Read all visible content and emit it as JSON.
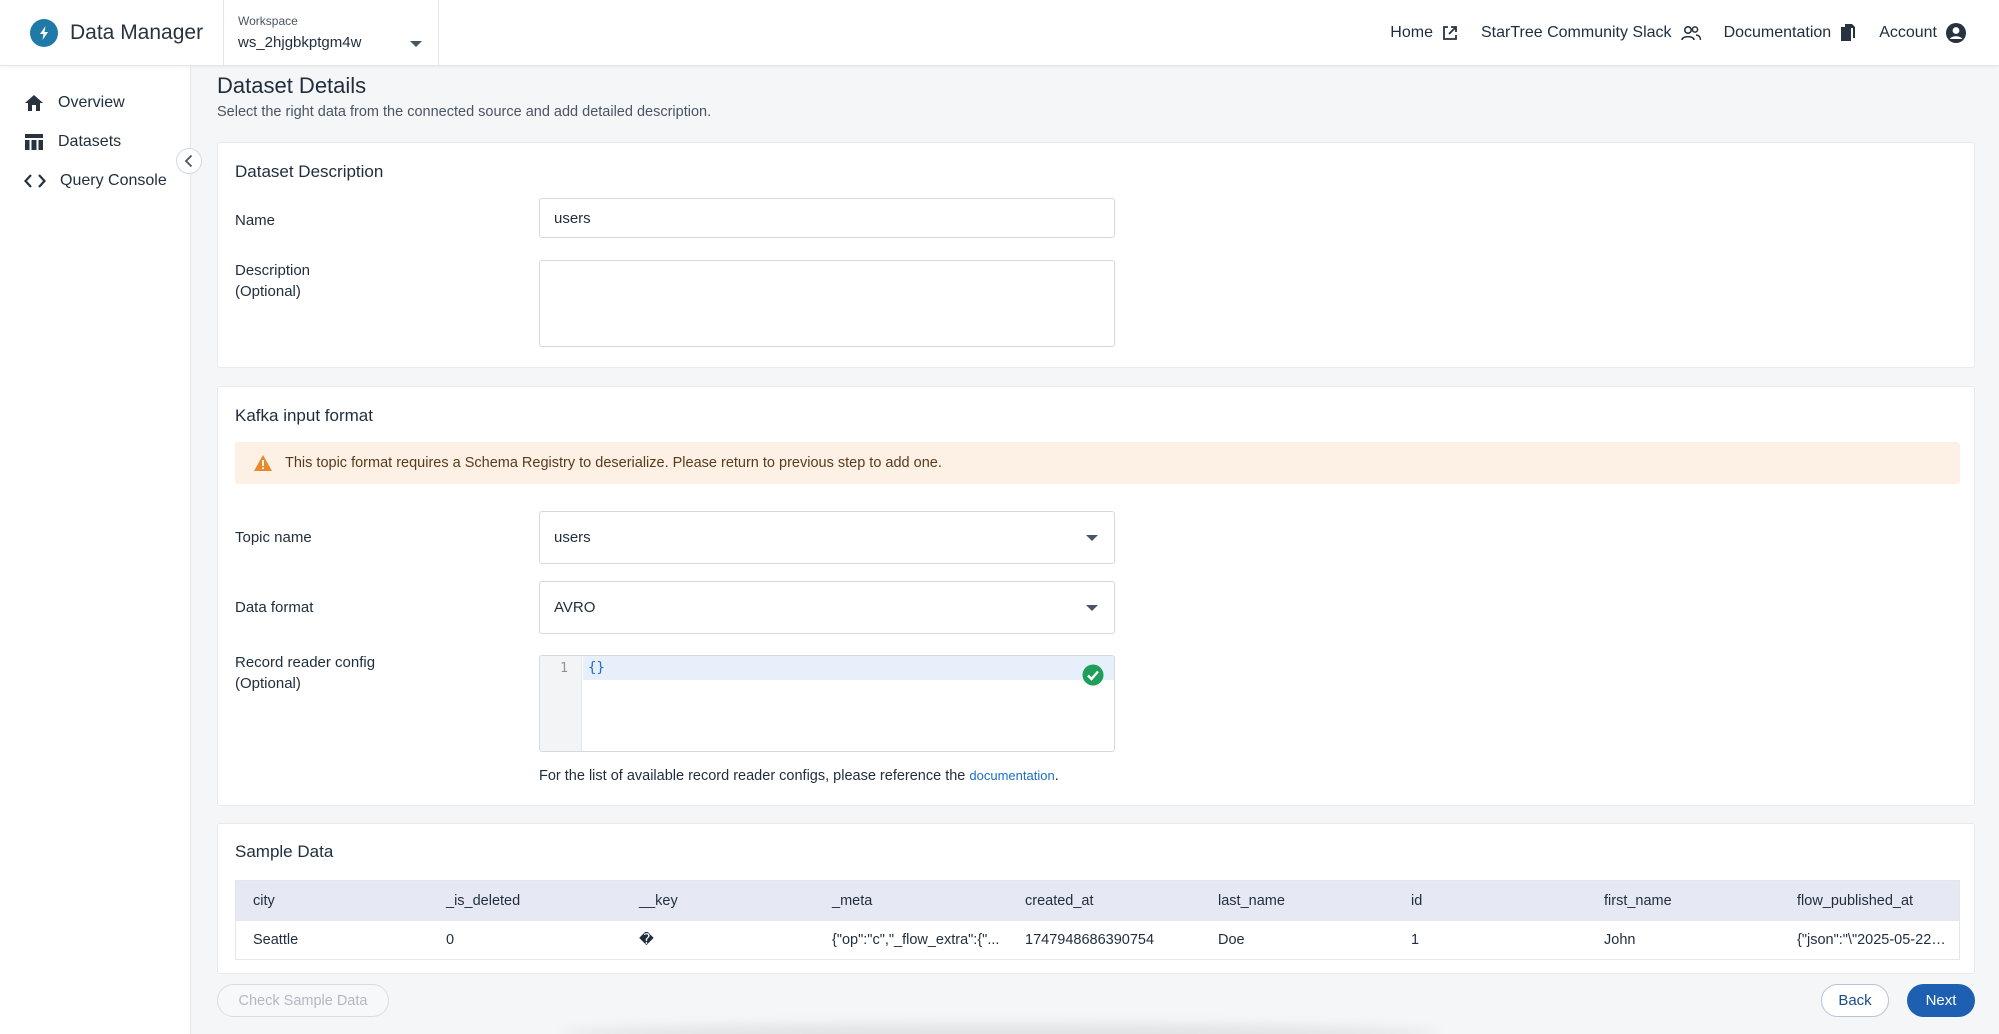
{
  "app": {
    "title": "Data Manager",
    "accent": "#1f7aa8"
  },
  "workspace": {
    "label": "Workspace",
    "value": "ws_2hjgbkptgm4w"
  },
  "nav": {
    "home": "Home",
    "slack": "StarTree Community Slack",
    "docs": "Documentation",
    "account": "Account"
  },
  "sidebar": {
    "items": [
      {
        "label": "Overview",
        "icon": "home-icon"
      },
      {
        "label": "Datasets",
        "icon": "table-icon"
      },
      {
        "label": "Query Console",
        "icon": "code-icon"
      }
    ]
  },
  "page": {
    "title": "Dataset Details",
    "subtitle": "Select the right data from the connected source and add detailed description."
  },
  "description_card": {
    "title": "Dataset Description",
    "name_label": "Name",
    "name_value": "users",
    "desc_label_1": "Description",
    "desc_label_2": "(Optional)",
    "desc_value": ""
  },
  "kafka_card": {
    "title": "Kafka input format",
    "warning": "This topic format requires a Schema Registry to deserialize. Please return to previous step to add one.",
    "topic_label": "Topic name",
    "topic_value": "users",
    "format_label": "Data format",
    "format_value": "AVRO",
    "reader_label_1": "Record reader config",
    "reader_label_2": "(Optional)",
    "editor_line_number": "1",
    "editor_code": "{}",
    "hint_text": "For the list of available record reader configs, please reference the ",
    "hint_link": "documentation",
    "hint_end": "."
  },
  "sample_card": {
    "title": "Sample Data",
    "columns": [
      "city",
      "_is_deleted",
      "__key",
      "_meta",
      "created_at",
      "last_name",
      "id",
      "first_name",
      "flow_published_at"
    ],
    "row": [
      "Seattle",
      "0",
      "�",
      "{\"op\":\"c\",\"_flow_extra\":{\"...",
      "1747948686390754",
      "Doe",
      "1",
      "John",
      "{\"json\":\"\\\"2025-05-22T..."
    ]
  },
  "buttons": {
    "check_sample": "Check Sample Data",
    "back": "Back",
    "next": "Next"
  },
  "colors": {
    "primary": "#1d5fb0",
    "warning_bg": "#fdf1e6",
    "warning_icon": "#e8892b",
    "success": "#1e9e5a",
    "table_header": "#e6e9f3"
  }
}
